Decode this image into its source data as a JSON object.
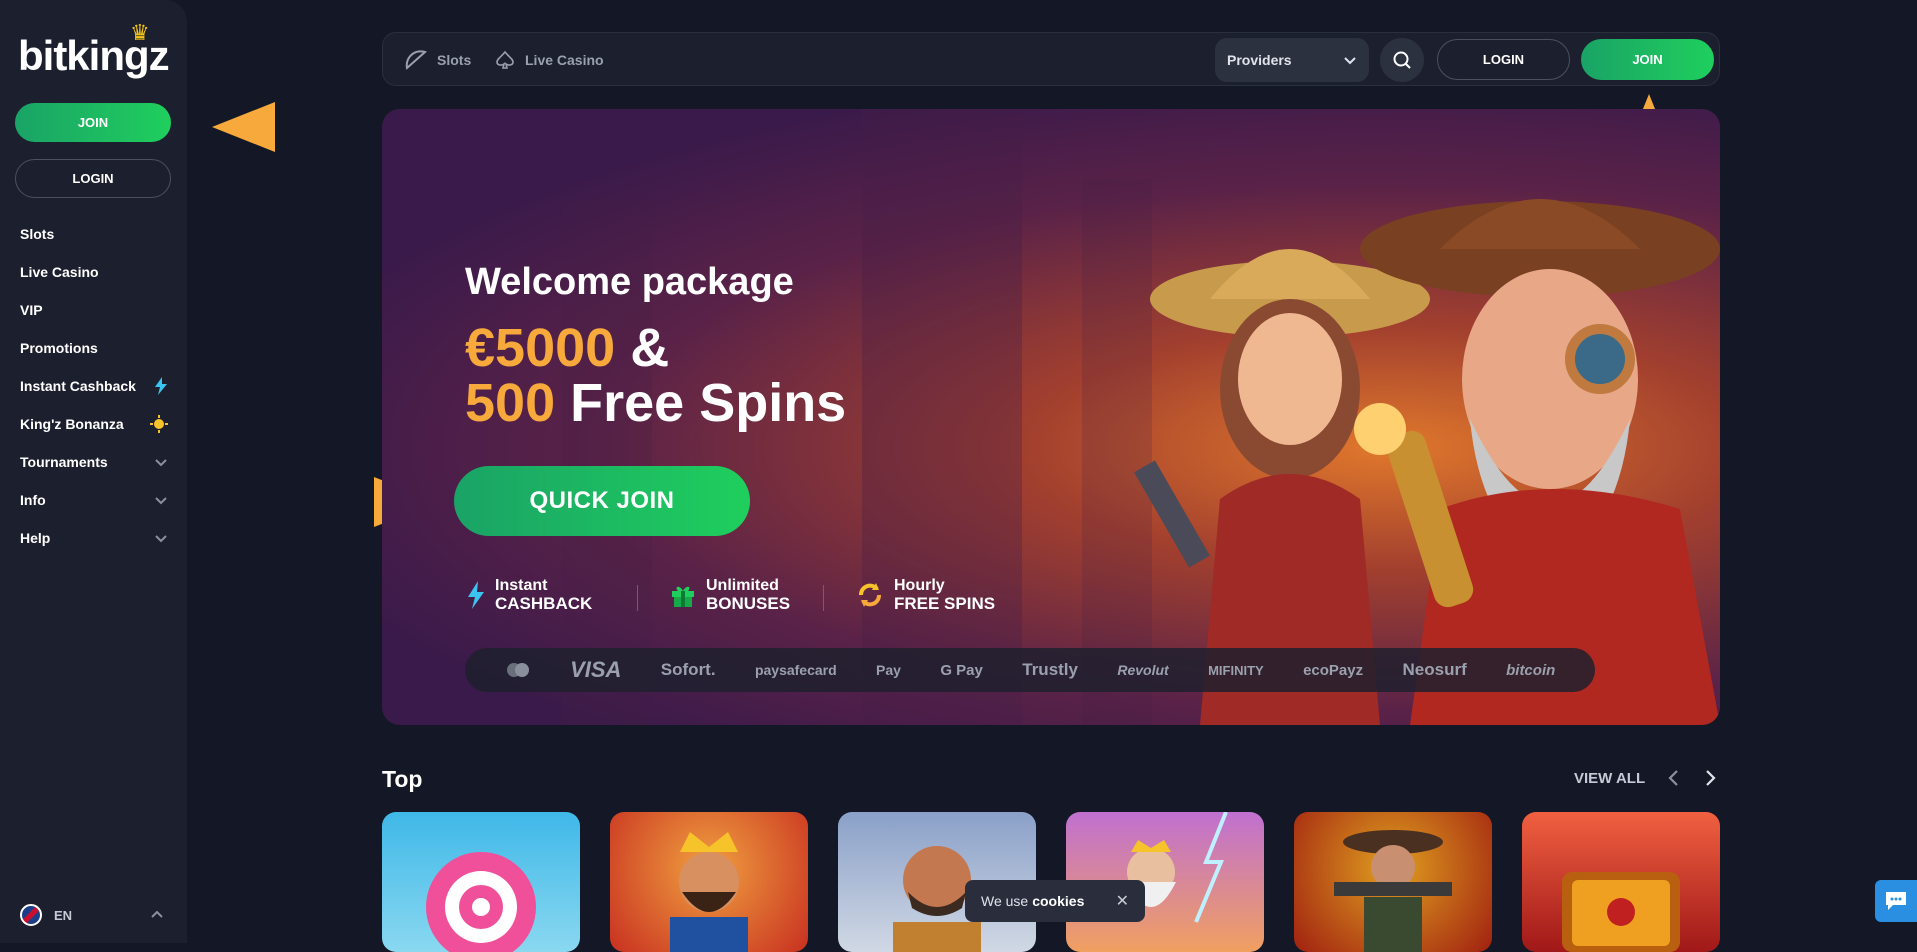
{
  "sidebar": {
    "logo": "bitkingz",
    "join_label": "JOIN",
    "login_label": "LOGIN",
    "items": [
      {
        "label": "Slots"
      },
      {
        "label": "Live Casino"
      },
      {
        "label": "VIP"
      },
      {
        "label": "Promotions"
      },
      {
        "label": "Instant Cashback",
        "icon": "lightning-icon"
      },
      {
        "label": "King'z Bonanza",
        "icon": "sun-icon"
      },
      {
        "label": "Tournaments",
        "icon": "chevron-down-icon"
      },
      {
        "label": "Info",
        "icon": "chevron-down-icon"
      },
      {
        "label": "Help",
        "icon": "chevron-down-icon"
      }
    ],
    "language": "EN"
  },
  "topbar": {
    "slots_label": "Slots",
    "live_casino_label": "Live Casino",
    "providers_label": "Providers",
    "login_label": "LOGIN",
    "join_label": "JOIN"
  },
  "hero": {
    "title": "Welcome package",
    "amount": "€5000",
    "amount_suffix": "&",
    "spins_count": "500",
    "spins_label": "Free Spins",
    "cta_label": "QUICK JOIN",
    "features": [
      {
        "line1": "Instant",
        "line2": "CASHBACK"
      },
      {
        "line1": "Unlimited",
        "line2": "BONUSES"
      },
      {
        "line1": "Hourly",
        "line2": "FREE SPINS"
      }
    ],
    "payments": [
      "VISA",
      "Sofort.",
      "paysafecard",
      "Pay",
      "G Pay",
      "Trustly",
      "Revolut",
      "MIFINITY",
      "ecoPayz",
      "Neosurf",
      "bitcoin"
    ]
  },
  "top_section": {
    "title": "Top",
    "view_all_label": "VIEW ALL"
  },
  "cookie_banner": {
    "text": "We use",
    "bold": "cookies"
  },
  "colors": {
    "accent_orange": "#f7a93b",
    "join_green": "#1fcf5d",
    "background": "#141826",
    "panel": "#1c202e"
  }
}
